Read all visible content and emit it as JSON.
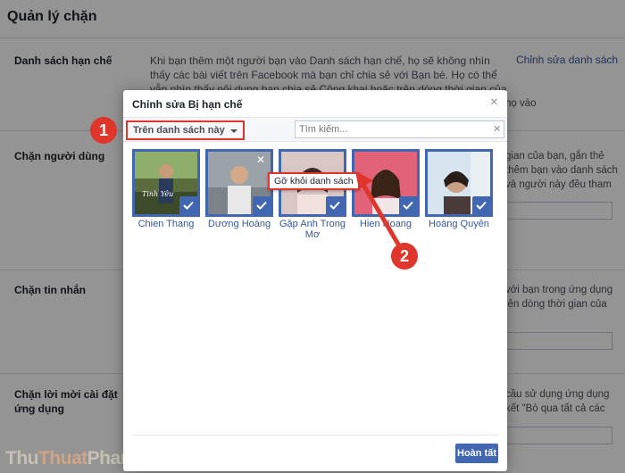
{
  "page": {
    "title": "Quản lý chặn",
    "sections": [
      {
        "title": "Danh sách hạn chế",
        "desc": "Khi bạn thêm một người bạn vào Danh sách hạn chế, họ sẽ không nhìn thấy các bài viết trên Facebook mà bạn chỉ chia sẻ với Bạn bè. Họ có thể vẫn nhìn thấy nội dung bạn chia sẻ Công khai hoặc trên dòng thời gian của một người bạn chung cũng như các bài"
      },
      {
        "title": "Chặn người dùng"
      },
      {
        "title": "Chặn tin nhắn"
      },
      {
        "title": "Chặn lời mời cài đặt ứng dụng"
      }
    ],
    "edit_link": "Chỉnh sửa danh sách",
    "right_snippets": [
      "họ vào",
      "gian của bạn, gắn thẻ",
      "thêm bạn vào danh sách",
      "và người này đều tham",
      "với bạn trong ứng dụng",
      "lên dòng thời gian của",
      "cầu sử dụng ứng dụng",
      "kết \"Bỏ qua tất cả các"
    ]
  },
  "dialog": {
    "title": "Chỉnh sửa Bị hạn chế",
    "filter_label": "Trên danh sách này",
    "search_placeholder": "Tìm kiếm...",
    "tooltip": "Gỡ khỏi danh sách",
    "done_label": "Hoàn tất",
    "friends": [
      {
        "name": "Chien Thang"
      },
      {
        "name": "Dương Hoàng"
      },
      {
        "name": "Gặp Anh Trong Mơ"
      },
      {
        "name": "Hien Hoang"
      },
      {
        "name": "Hoàng Quyên"
      }
    ]
  },
  "annotations": {
    "badge1": "1",
    "badge2": "2"
  },
  "watermark": {
    "part1": "Thu",
    "part2": "Thuat",
    "part3": "PhanMem.vn"
  },
  "colors": {
    "accent": "#4267b2",
    "highlight": "#e0352b",
    "link": "#365899"
  }
}
